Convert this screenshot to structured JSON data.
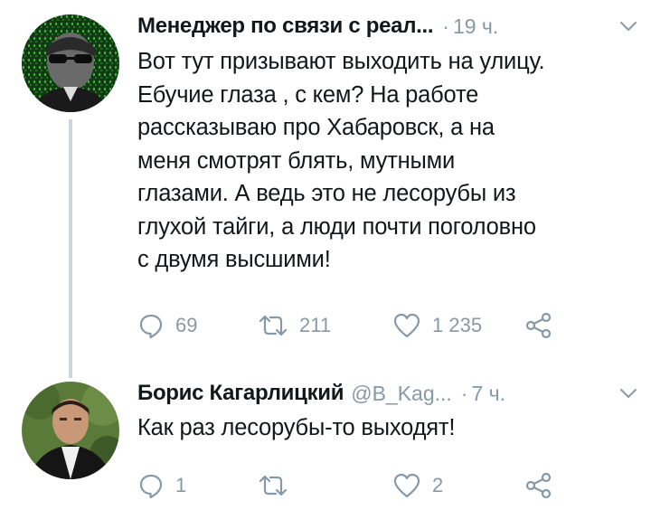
{
  "tweets": [
    {
      "author_name": "Менеджер по связи с реал...",
      "handle": "",
      "time": "19 ч.",
      "text": "Вот тут призывают выходить на улицу.\nЕбучие глаза , с кем? На работе\nрассказываю про Хабаровск, а на\nменя смотрят блять, мутными\nглазами. А ведь это не лесорубы из\nглухой тайги, а люди почти поголовно\nс двумя высшими!",
      "replies": "69",
      "retweets": "211",
      "likes": "1 235"
    },
    {
      "author_name": "Борис Кагарлицкий",
      "handle": "@B_Kag...",
      "time": "7 ч.",
      "text": "Как раз лесорубы-то выходят!",
      "replies": "1",
      "retweets": "",
      "likes": "2"
    }
  ],
  "separator": "·",
  "colors": {
    "text": "#14171a",
    "secondary": "#8899a6",
    "thread_line": "#ccd6dd"
  },
  "icons": {
    "reply": "reply-icon",
    "retweet": "retweet-icon",
    "like": "heart-icon",
    "share": "share-icon",
    "menu": "chevron-down-icon"
  }
}
